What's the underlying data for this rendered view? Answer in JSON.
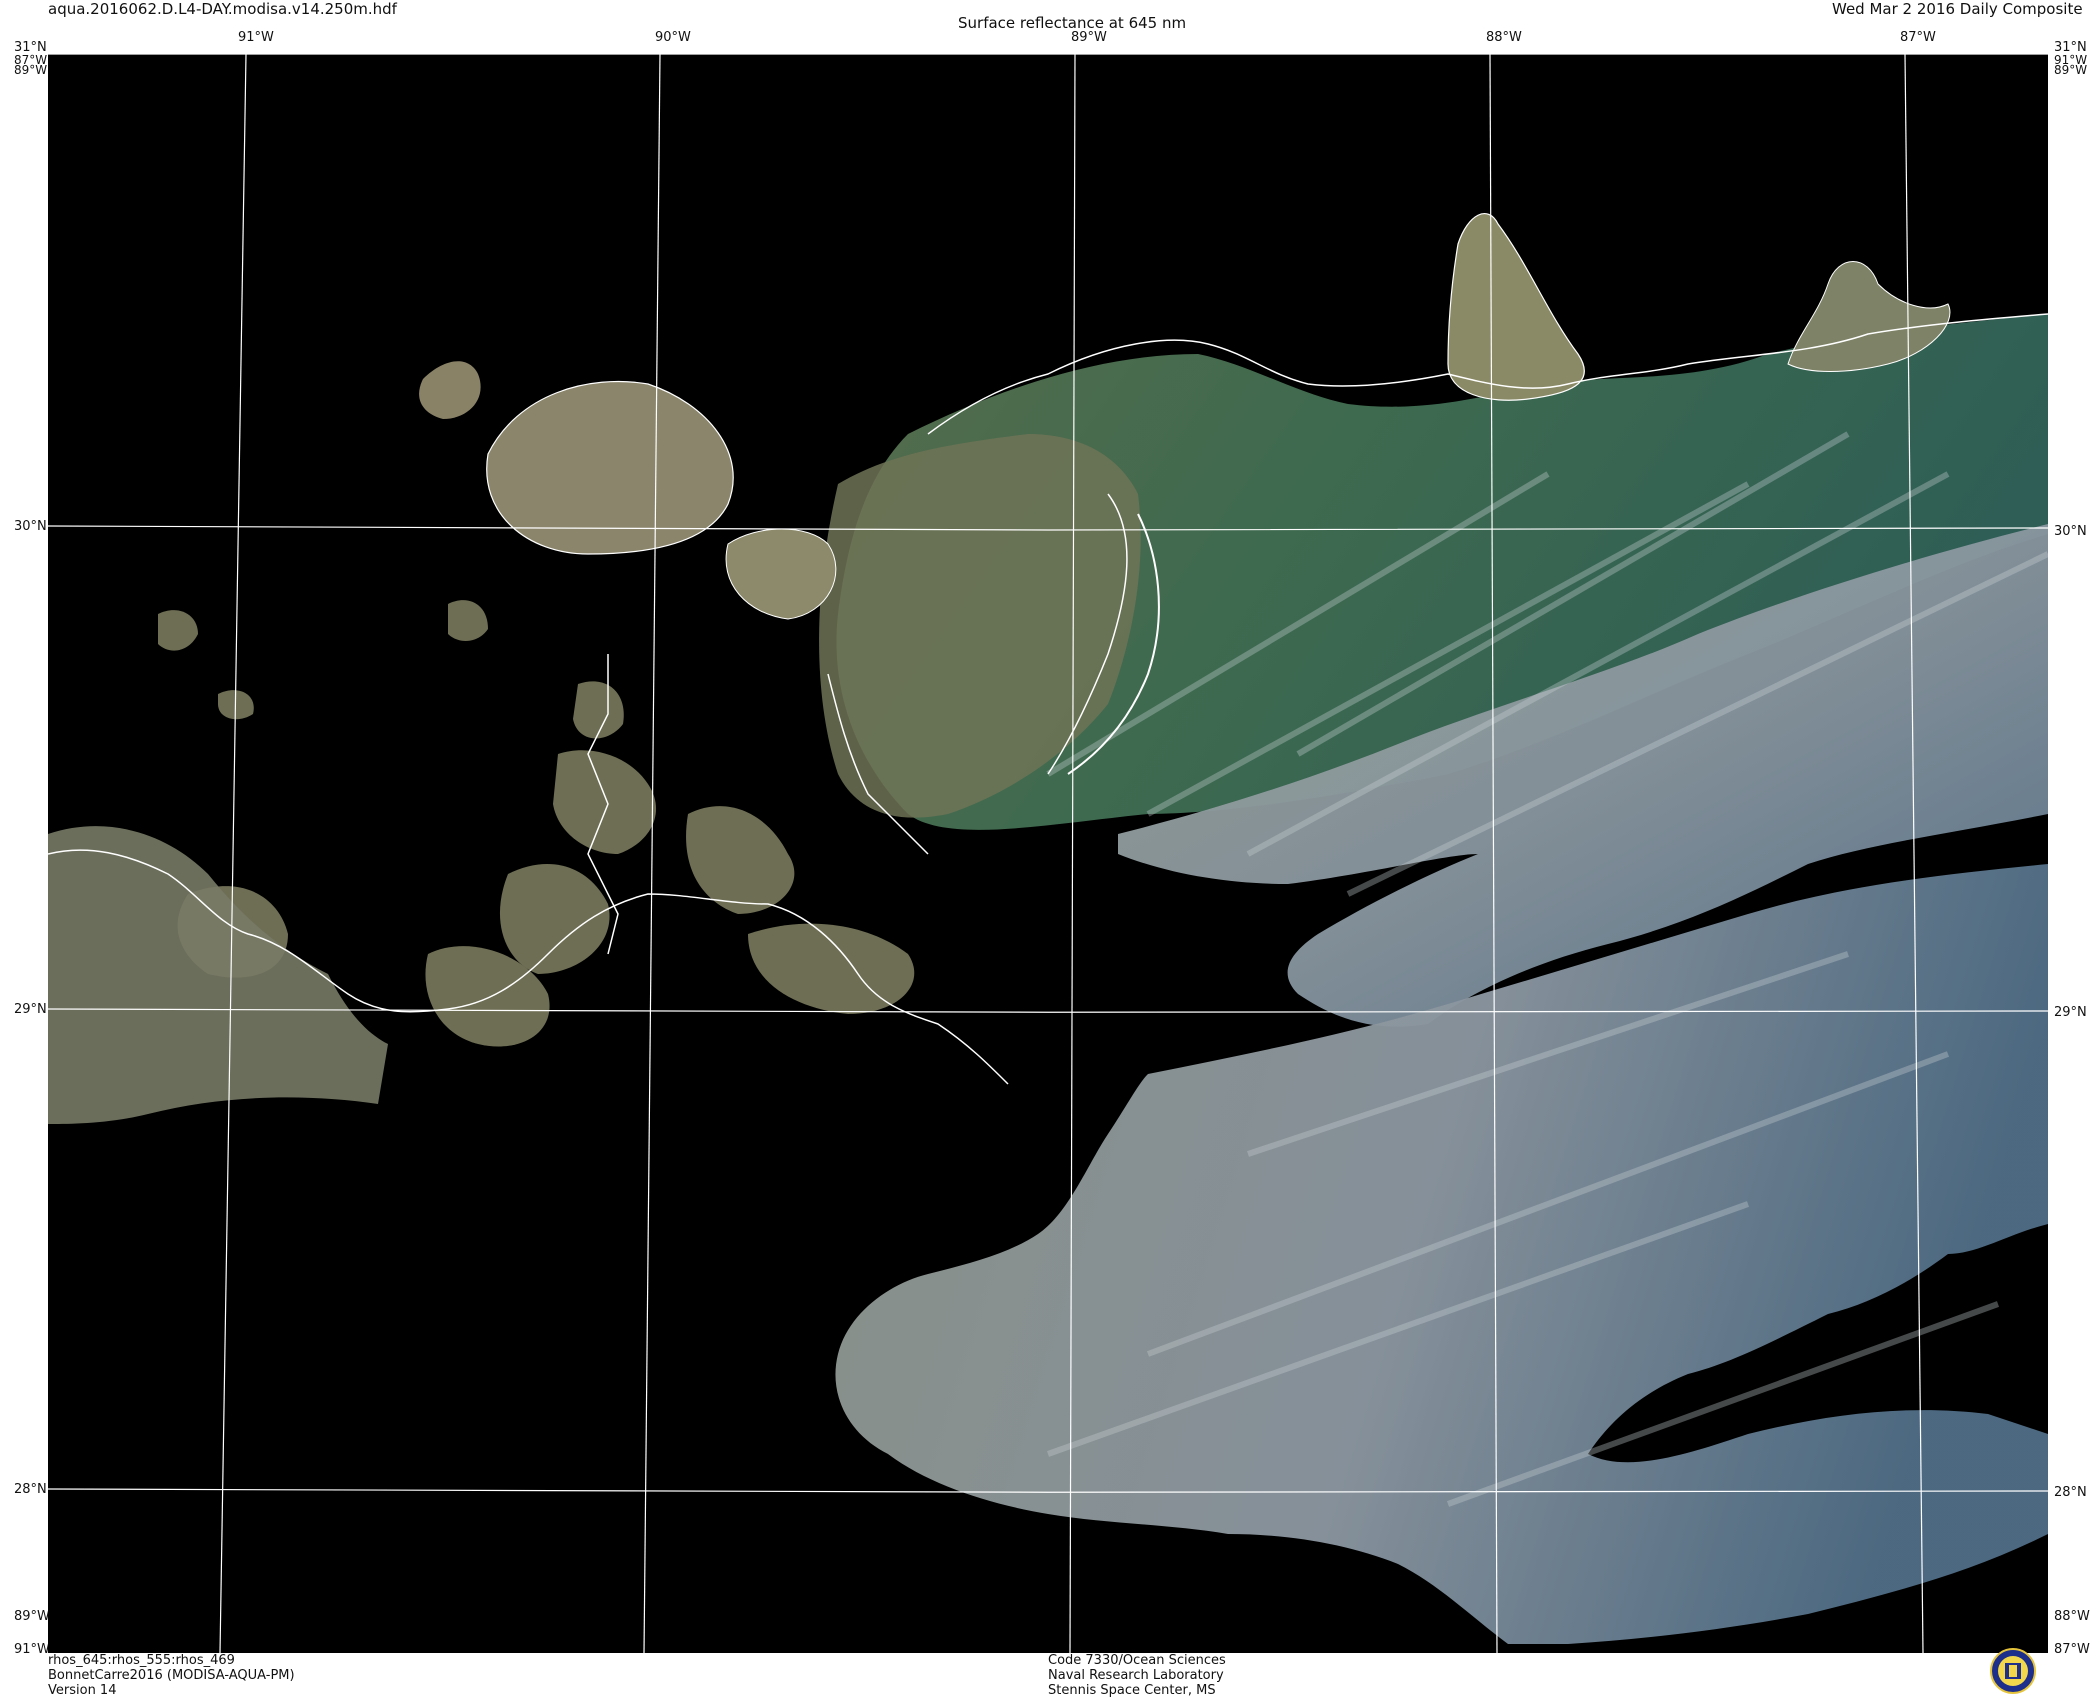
{
  "header": {
    "filename": "aqua.2016062.D.L4-DAY.modisa.v14.250m.hdf",
    "title": "Surface reflectance at 645 nm",
    "date": "Wed Mar  2 2016 Daily Composite"
  },
  "axes": {
    "lon_top": [
      "91°W",
      "90°W",
      "89°W",
      "88°W",
      "87°W"
    ],
    "lat_right": [
      "30°N",
      "29°N",
      "28°N"
    ],
    "lat_left": [
      "30°N",
      "29°N",
      "28°N"
    ],
    "corner_top_left": [
      "31°N",
      "87°W",
      "89°W"
    ],
    "corner_top_right": [
      "31°N",
      "91°W",
      "89°W"
    ],
    "corner_bottom_left": [
      "89°W",
      "91°W"
    ],
    "corner_bottom_right": [
      "88°W",
      "87°W"
    ]
  },
  "footer": {
    "left": [
      "rhos_645:rhos_555:rhos_469",
      "BonnetCarre2016 (MODISA-AQUA-PM)",
      "Version 14"
    ],
    "center": [
      "Code 7330/Ocean Sciences",
      "Naval Research Laboratory",
      "Stennis Space Center, MS"
    ]
  },
  "colors": {
    "background": "#000000",
    "graticule": "#ffffff",
    "coastline": "#ffffff",
    "turbid_water": "#7a7a5c",
    "nearshore_green": "#3d6b4a",
    "cloud": "#8f9aa3",
    "offshore_blue": "#4c6a80"
  },
  "logo": "navy-seal-icon"
}
